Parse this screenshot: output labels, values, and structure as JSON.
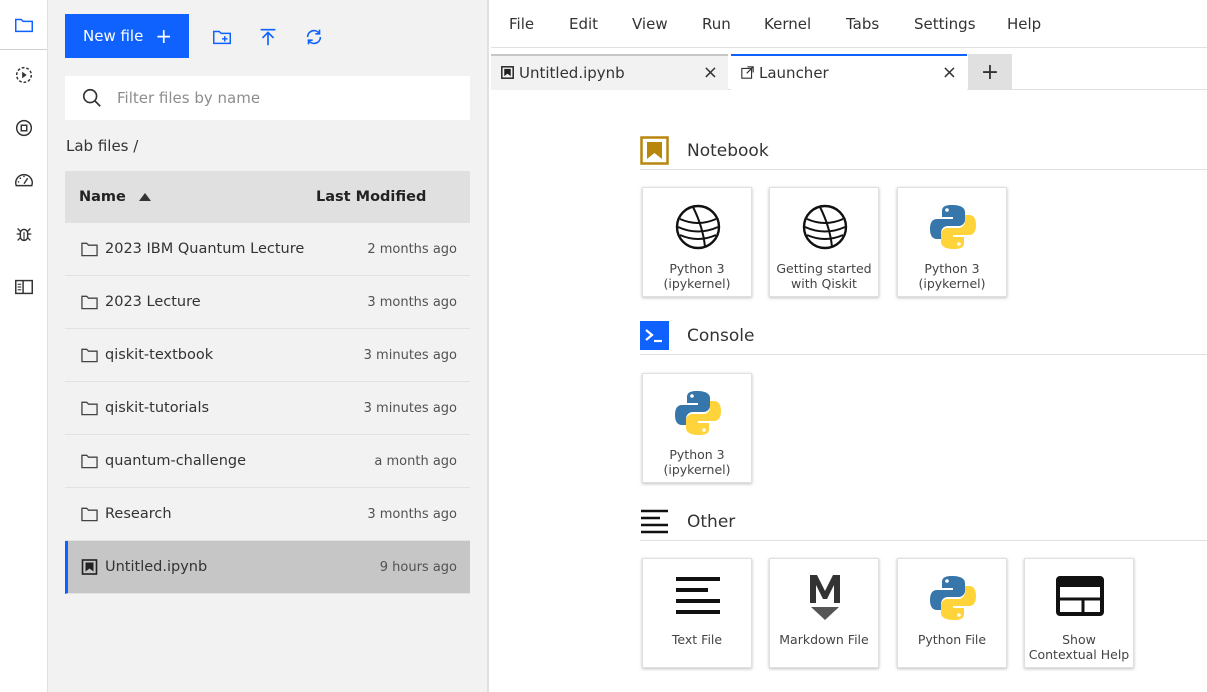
{
  "activity_bar": {
    "items": [
      {
        "icon": "folder-icon"
      },
      {
        "icon": "running-icon"
      },
      {
        "icon": "stop-icon"
      },
      {
        "icon": "dashboard-icon"
      },
      {
        "icon": "bug-icon"
      },
      {
        "icon": "table-of-contents-icon"
      }
    ]
  },
  "file_browser": {
    "new_file_label": "New file",
    "new_file_plus": "+",
    "search_placeholder": "Filter files by name",
    "breadcrumb": "Lab files /",
    "columns": {
      "name": "Name",
      "modified": "Last Modified"
    },
    "rows": [
      {
        "name": "2023 IBM Quantum Lecture",
        "modified": "2 months ago",
        "type": "folder"
      },
      {
        "name": "2023 Lecture",
        "modified": "3 months ago",
        "type": "folder"
      },
      {
        "name": "qiskit-textbook",
        "modified": "3 minutes ago",
        "type": "folder"
      },
      {
        "name": "qiskit-tutorials",
        "modified": "3 minutes ago",
        "type": "folder"
      },
      {
        "name": "quantum-challenge",
        "modified": "a month ago",
        "type": "folder"
      },
      {
        "name": "Research",
        "modified": "3 months ago",
        "type": "folder"
      },
      {
        "name": "Untitled.ipynb",
        "modified": "9 hours ago",
        "type": "notebook"
      }
    ]
  },
  "menubar": {
    "items": [
      "File",
      "Edit",
      "View",
      "Run",
      "Kernel",
      "Tabs",
      "Settings",
      "Help"
    ]
  },
  "tabs": [
    {
      "label": "Untitled.ipynb",
      "close": "×"
    },
    {
      "label": "Launcher",
      "close": "×"
    }
  ],
  "add_tab": "+",
  "launcher": {
    "sections": {
      "notebook": "Notebook",
      "console": "Console",
      "other": "Other"
    },
    "notebook_cards": [
      {
        "line1": "Python 3",
        "line2": "(ipykernel)"
      },
      {
        "line1": "Getting started",
        "line2": "with Qiskit"
      },
      {
        "line1": "Python 3",
        "line2": "(ipykernel)"
      }
    ],
    "console_cards": [
      {
        "line1": "Python 3",
        "line2": "(ipykernel)"
      }
    ],
    "other_cards": [
      {
        "line1": "Text File",
        "line2": ""
      },
      {
        "line1": "Markdown File",
        "line2": ""
      },
      {
        "line1": "Python File",
        "line2": ""
      },
      {
        "line1": "Show",
        "line2": "Contextual Help"
      }
    ]
  },
  "colors": {
    "accent": "#0f62fe",
    "notebook_gold": "#b8860b"
  }
}
